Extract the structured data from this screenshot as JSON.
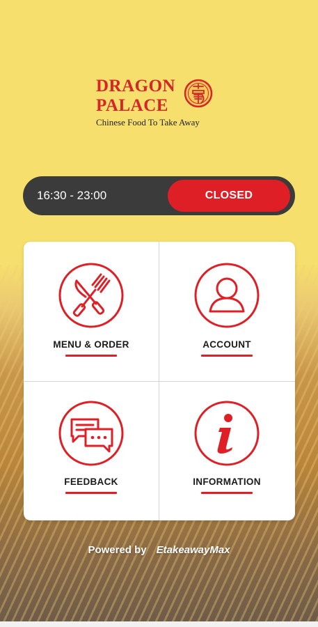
{
  "logo": {
    "line1": "DRAGON",
    "line2": "PALACE",
    "tagline": "Chinese Food To Take Away",
    "seal_icon": "dragon-seal-icon"
  },
  "hours": {
    "time_range": "16:30 - 23:00",
    "status": "CLOSED"
  },
  "menu_grid": {
    "items": [
      {
        "label": "MENU & ORDER",
        "icon": "knife-fork-icon"
      },
      {
        "label": "ACCOUNT",
        "icon": "user-icon"
      },
      {
        "label": "FEEDBACK",
        "icon": "chat-bubbles-icon"
      },
      {
        "label": "INFORMATION",
        "icon": "info-icon"
      }
    ]
  },
  "footer": {
    "powered_by": "Powered by",
    "brand": "EtakeawayMax"
  },
  "colors": {
    "background_yellow": "#f6df6c",
    "accent_red": "#df1f26",
    "bar_dark": "#3b3b3b"
  }
}
